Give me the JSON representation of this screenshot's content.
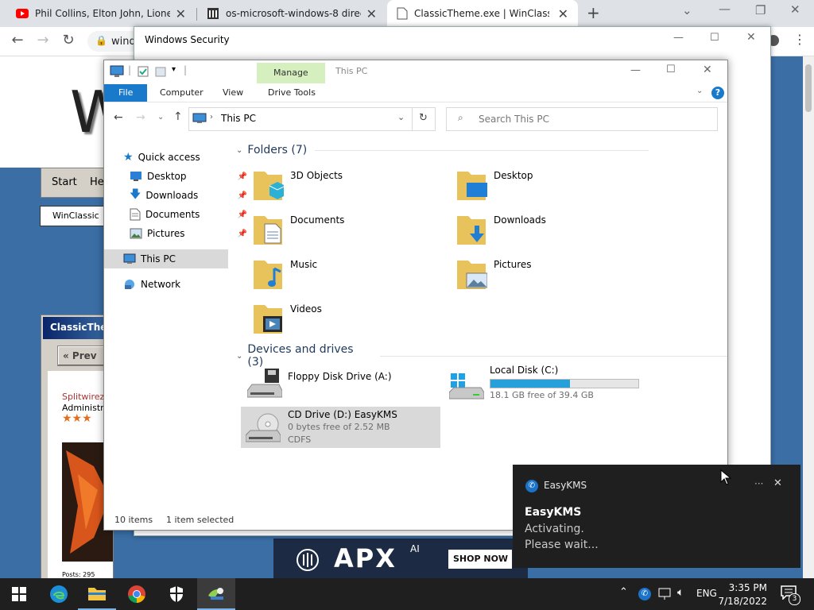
{
  "browser": {
    "tabs": [
      {
        "title": "Phil Collins, Elton John, Lionel Ric",
        "icon": "youtube-icon"
      },
      {
        "title": "os-microsoft-windows-8 directo",
        "icon": "archive-icon"
      },
      {
        "title": "ClassicTheme.exe | WinClassic",
        "icon": "page-icon"
      }
    ],
    "address_partial": "windo"
  },
  "webpage": {
    "logo_partial": "W",
    "nav_start": "Start",
    "nav_help_partial": "He",
    "site_button": "WinClassic",
    "panel_title_partial": "ClassicThe",
    "prev_button": "« Prev",
    "author_partial": "Splitwirez",
    "role_partial": "Administra",
    "posts_partial": "Posts: 295",
    "ad_brand": "APX",
    "ad_brand_sup": "AI",
    "ad_button": "SHOP NOW"
  },
  "security_window": {
    "title": "Windows Security"
  },
  "explorer": {
    "title": "This PC",
    "context_tab": "Manage",
    "ribbon_tabs": [
      "File",
      "Computer",
      "View",
      "Drive Tools"
    ],
    "address": "This PC",
    "search_placeholder": "Search This PC",
    "sidebar": [
      {
        "label": "Quick access",
        "icon": "star-icon"
      },
      {
        "label": "Desktop",
        "icon": "desktop-icon"
      },
      {
        "label": "Downloads",
        "icon": "download-icon"
      },
      {
        "label": "Documents",
        "icon": "documents-icon"
      },
      {
        "label": "Pictures",
        "icon": "pictures-icon"
      },
      {
        "label": "This PC",
        "icon": "computer-icon"
      },
      {
        "label": "Network",
        "icon": "network-icon"
      }
    ],
    "folders_header": "Folders (7)",
    "folders": [
      "3D Objects",
      "Desktop",
      "Documents",
      "Downloads",
      "Music",
      "Pictures",
      "Videos"
    ],
    "devices_header": "Devices and drives (3)",
    "drives": [
      {
        "name": "Floppy Disk Drive (A:)",
        "line2": "",
        "line3": ""
      },
      {
        "name": "Local Disk (C:)",
        "line2": "18.1 GB free of 39.4 GB",
        "line3": "",
        "used_fraction": 0.54
      },
      {
        "name": "CD Drive (D:) EasyKMS",
        "line2": "0 bytes free of 2.52 MB",
        "line3": "CDFS"
      }
    ],
    "status_items": "10 items",
    "status_selected": "1 item selected"
  },
  "toast": {
    "app": "EasyKMS",
    "title": "EasyKMS",
    "line1": "Activating.",
    "line2": "Please wait...",
    "more": "···"
  },
  "taskbar": {
    "lang": "ENG",
    "time": "3:35 PM",
    "date": "7/18/2022",
    "notif_count": "3"
  },
  "colors": {
    "accent": "#0078d7",
    "taskbar": "#1f1f1f",
    "web_bg": "#3a6ea5"
  }
}
